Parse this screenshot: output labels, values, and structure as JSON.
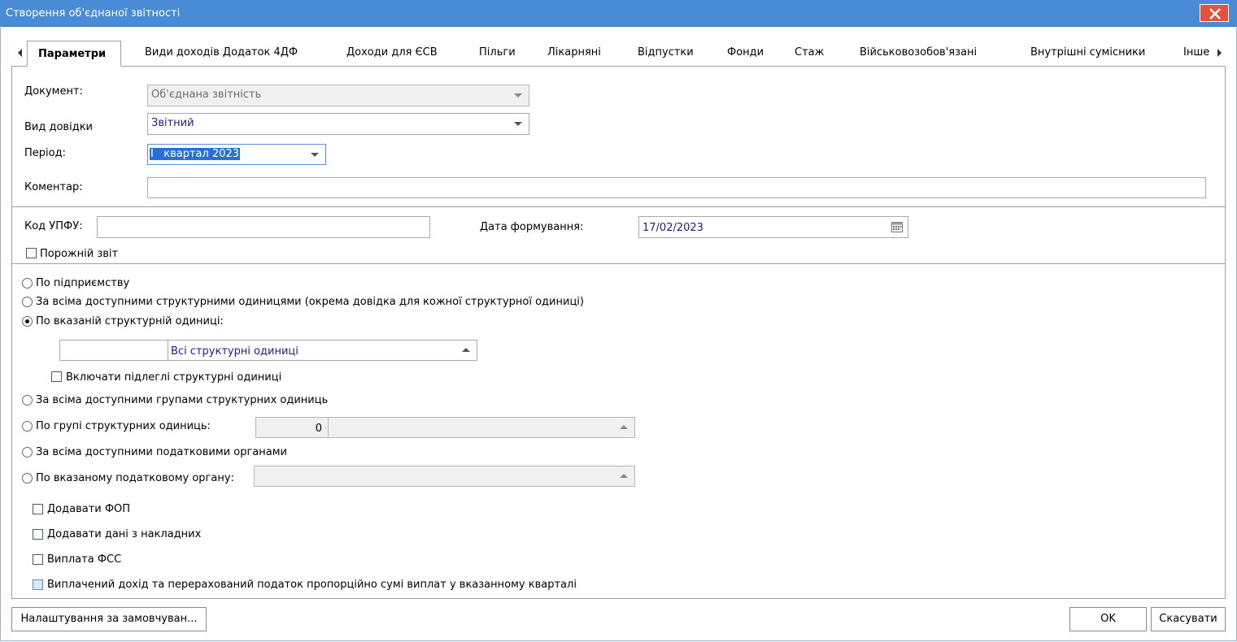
{
  "window": {
    "title": "Створення об'єднаної звітності"
  },
  "tabs": [
    {
      "label": "Параметри",
      "active": true
    },
    {
      "label": "Види доходів Додаток 4ДФ"
    },
    {
      "label": "Доходи для ЄСВ"
    },
    {
      "label": "Пільги"
    },
    {
      "label": "Лікарняні"
    },
    {
      "label": "Відпустки"
    },
    {
      "label": "Фонди"
    },
    {
      "label": "Стаж"
    },
    {
      "label": "Військовозобов'язані"
    },
    {
      "label": "Внутрішні сумісники"
    },
    {
      "label": "Інше"
    }
  ],
  "form": {
    "document": {
      "label": "Документ:",
      "value": "Об'єднана звітність"
    },
    "report_type": {
      "label": "Вид довідки",
      "value": "Звітний"
    },
    "period": {
      "label": "Період:",
      "value": "І   квартал 2023"
    },
    "comment": {
      "label": "Коментар:",
      "value": ""
    },
    "upfu_code": {
      "label": "Код УПФУ:",
      "value": ""
    },
    "form_date": {
      "label": "Дата формування:",
      "value": "17/02/2023"
    },
    "empty_report": {
      "label": "Порожній звіт",
      "checked": false
    }
  },
  "scope": {
    "by_enterprise": {
      "label": "По підприємству",
      "selected": false
    },
    "all_units": {
      "label": "За всіма доступними структурними одиницями (окрема довідка для кожної структурної одиниці)",
      "selected": false
    },
    "specified_unit": {
      "label": "По вказаній структурній одиниці:",
      "selected": true
    },
    "unit_code": "",
    "unit_value": "Всі структурні одиниці",
    "include_sub_units": {
      "label": "Включати підлеглі структурні одиниці",
      "checked": false
    },
    "all_groups": {
      "label": "За всіма доступними групами структурних одиниць",
      "selected": false
    },
    "by_group": {
      "label": "По групі структурних одиниць:",
      "selected": false
    },
    "group_code": "0",
    "group_value": "",
    "all_tax_offices": {
      "label": "За всіма доступними податковими органами",
      "selected": false
    },
    "by_tax_office": {
      "label": "По вказаному податковому органу:",
      "selected": false
    },
    "tax_office_value": ""
  },
  "options": {
    "add_fop": {
      "label": "Додавати ФОП",
      "checked": false
    },
    "add_invoice_data": {
      "label": "Додавати дані з накладних",
      "checked": false
    },
    "fss_payment": {
      "label": "Виплата ФСС",
      "checked": false
    },
    "proportional": {
      "label": "Виплачений дохід та перерахований податок пропорційно сумі виплат у вказанному кварталі",
      "checked": false
    }
  },
  "buttons": {
    "defaults": "Налаштування за замовчуван...",
    "ok": "OK",
    "cancel": "Скасувати"
  },
  "colors": {
    "titlebar": "#4a8bd6",
    "close": "#e0533f",
    "selection": "#2b6fd6",
    "value_text": "#1c1c8c"
  }
}
